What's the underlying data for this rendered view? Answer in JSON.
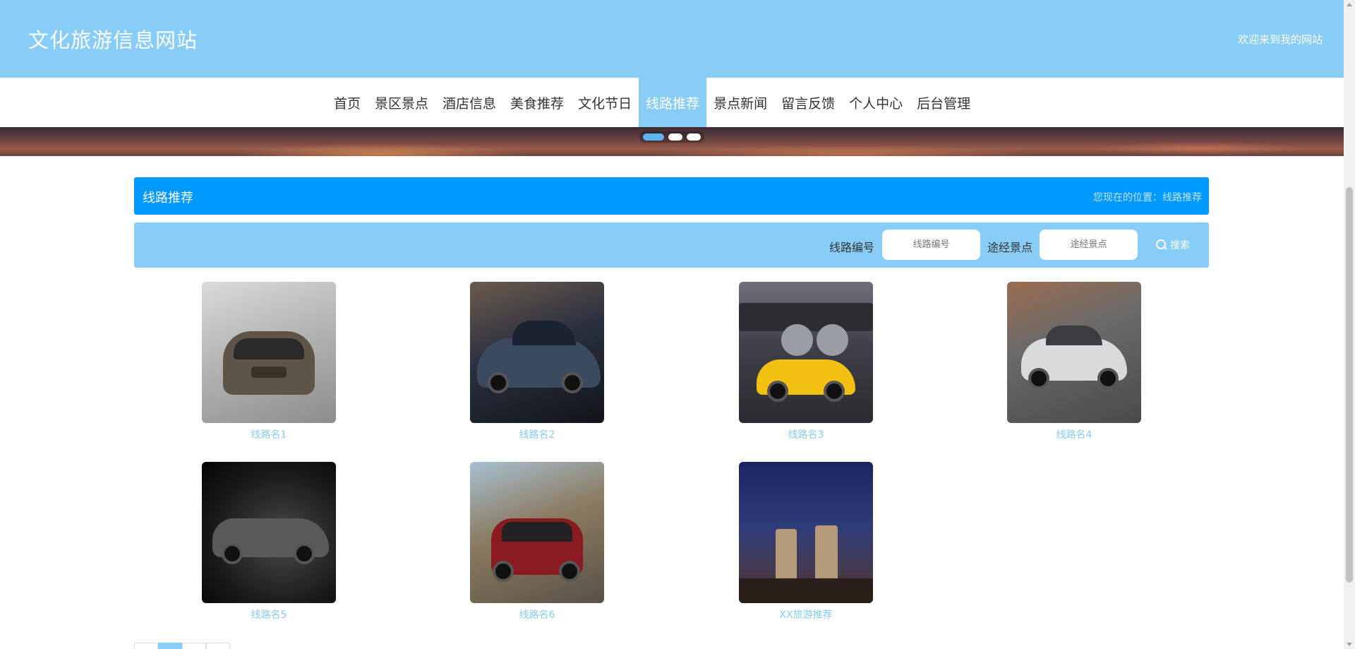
{
  "header": {
    "site_title": "文化旅游信息网站",
    "welcome": "欢迎来到我的网站"
  },
  "nav": {
    "items": [
      {
        "label": "首页"
      },
      {
        "label": "景区景点"
      },
      {
        "label": "酒店信息"
      },
      {
        "label": "美食推荐"
      },
      {
        "label": "文化节日"
      },
      {
        "label": "线路推荐",
        "active": true
      },
      {
        "label": "景点新闻"
      },
      {
        "label": "留言反馈"
      },
      {
        "label": "个人中心"
      },
      {
        "label": "后台管理"
      }
    ]
  },
  "banner": {
    "slides": 3,
    "active_index": 0
  },
  "section": {
    "title": "线路推荐",
    "breadcrumb": "您现在的位置：线路推荐"
  },
  "search": {
    "field1_label": "线路编号",
    "field1_placeholder": "线路编号",
    "field2_label": "途经景点",
    "field2_placeholder": "途经景点",
    "button_label": "搜索",
    "button_icon": "search-icon"
  },
  "routes": [
    {
      "name": "线路名1"
    },
    {
      "name": "线路名2"
    },
    {
      "name": "线路名3"
    },
    {
      "name": "线路名4"
    },
    {
      "name": "线路名5"
    },
    {
      "name": "线路名6"
    },
    {
      "name": "XX旅游推荐"
    }
  ],
  "colors": {
    "header_bg": "#87cdf7",
    "section_head_bg": "#0099ff",
    "active_nav_bg": "#87cdf7",
    "route_name": "#87cdf7"
  }
}
